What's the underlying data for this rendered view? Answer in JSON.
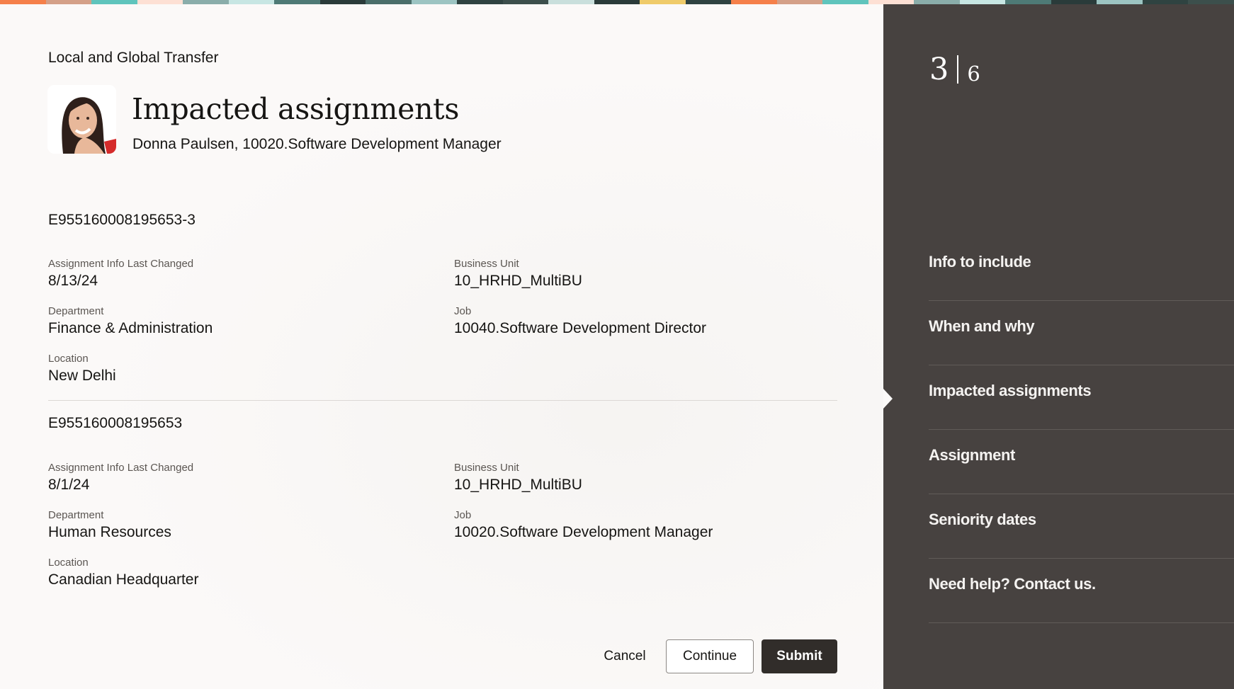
{
  "banner": {
    "colors": [
      "#f5804a",
      "#d4a088",
      "#5fc4bc",
      "#fde0d4",
      "#8aadaa",
      "#c7e6e3",
      "#4e7a76",
      "#2a3b3a",
      "#4a6e6a",
      "#9cc4c2",
      "#2f4341",
      "#3c4f4c",
      "#c9dfdc",
      "#2a3b3a",
      "#efcb6a",
      "#2f4341",
      "#f5804a",
      "#d4a088",
      "#5fc4bc",
      "#fde0d4",
      "#8aadaa",
      "#c7e6e3",
      "#4e7a76",
      "#2a3b3a",
      "#9cc4c2",
      "#2f4341",
      "#3c4f4c"
    ]
  },
  "header": {
    "section_title": "Local and Global Transfer",
    "page_title": "Impacted assignments",
    "person_subtitle": "Donna Paulsen, 10020.Software Development Manager",
    "avatar_alt": "Donna Paulsen photo"
  },
  "assignments": [
    {
      "id": "E955160008195653-3",
      "fields": {
        "last_changed": {
          "label": "Assignment Info Last Changed",
          "value": "8/13/24"
        },
        "business_unit": {
          "label": "Business Unit",
          "value": "10_HRHD_MultiBU"
        },
        "department": {
          "label": "Department",
          "value": "Finance & Administration"
        },
        "job": {
          "label": "Job",
          "value": "10040.Software Development Director"
        },
        "location": {
          "label": "Location",
          "value": "New Delhi"
        }
      }
    },
    {
      "id": "E955160008195653",
      "fields": {
        "last_changed": {
          "label": "Assignment Info Last Changed",
          "value": "8/1/24"
        },
        "business_unit": {
          "label": "Business Unit",
          "value": "10_HRHD_MultiBU"
        },
        "department": {
          "label": "Department",
          "value": "Human Resources"
        },
        "job": {
          "label": "Job",
          "value": "10020.Software Development Manager"
        },
        "location": {
          "label": "Location",
          "value": "Canadian Headquarter"
        }
      }
    }
  ],
  "actions": {
    "cancel": "Cancel",
    "continue": "Continue",
    "submit": "Submit"
  },
  "sidebar": {
    "step_current": "3",
    "step_total": "6",
    "active_index": 2,
    "items": [
      {
        "label": "Info to include"
      },
      {
        "label": "When and why"
      },
      {
        "label": "Impacted assignments"
      },
      {
        "label": "Assignment"
      },
      {
        "label": "Seniority dates"
      },
      {
        "label": "Need help? Contact us."
      }
    ]
  },
  "colors": {
    "sidebar_bg": "#474240",
    "submit_bg": "#312d2a",
    "page_bg": "#fbf9f8"
  }
}
